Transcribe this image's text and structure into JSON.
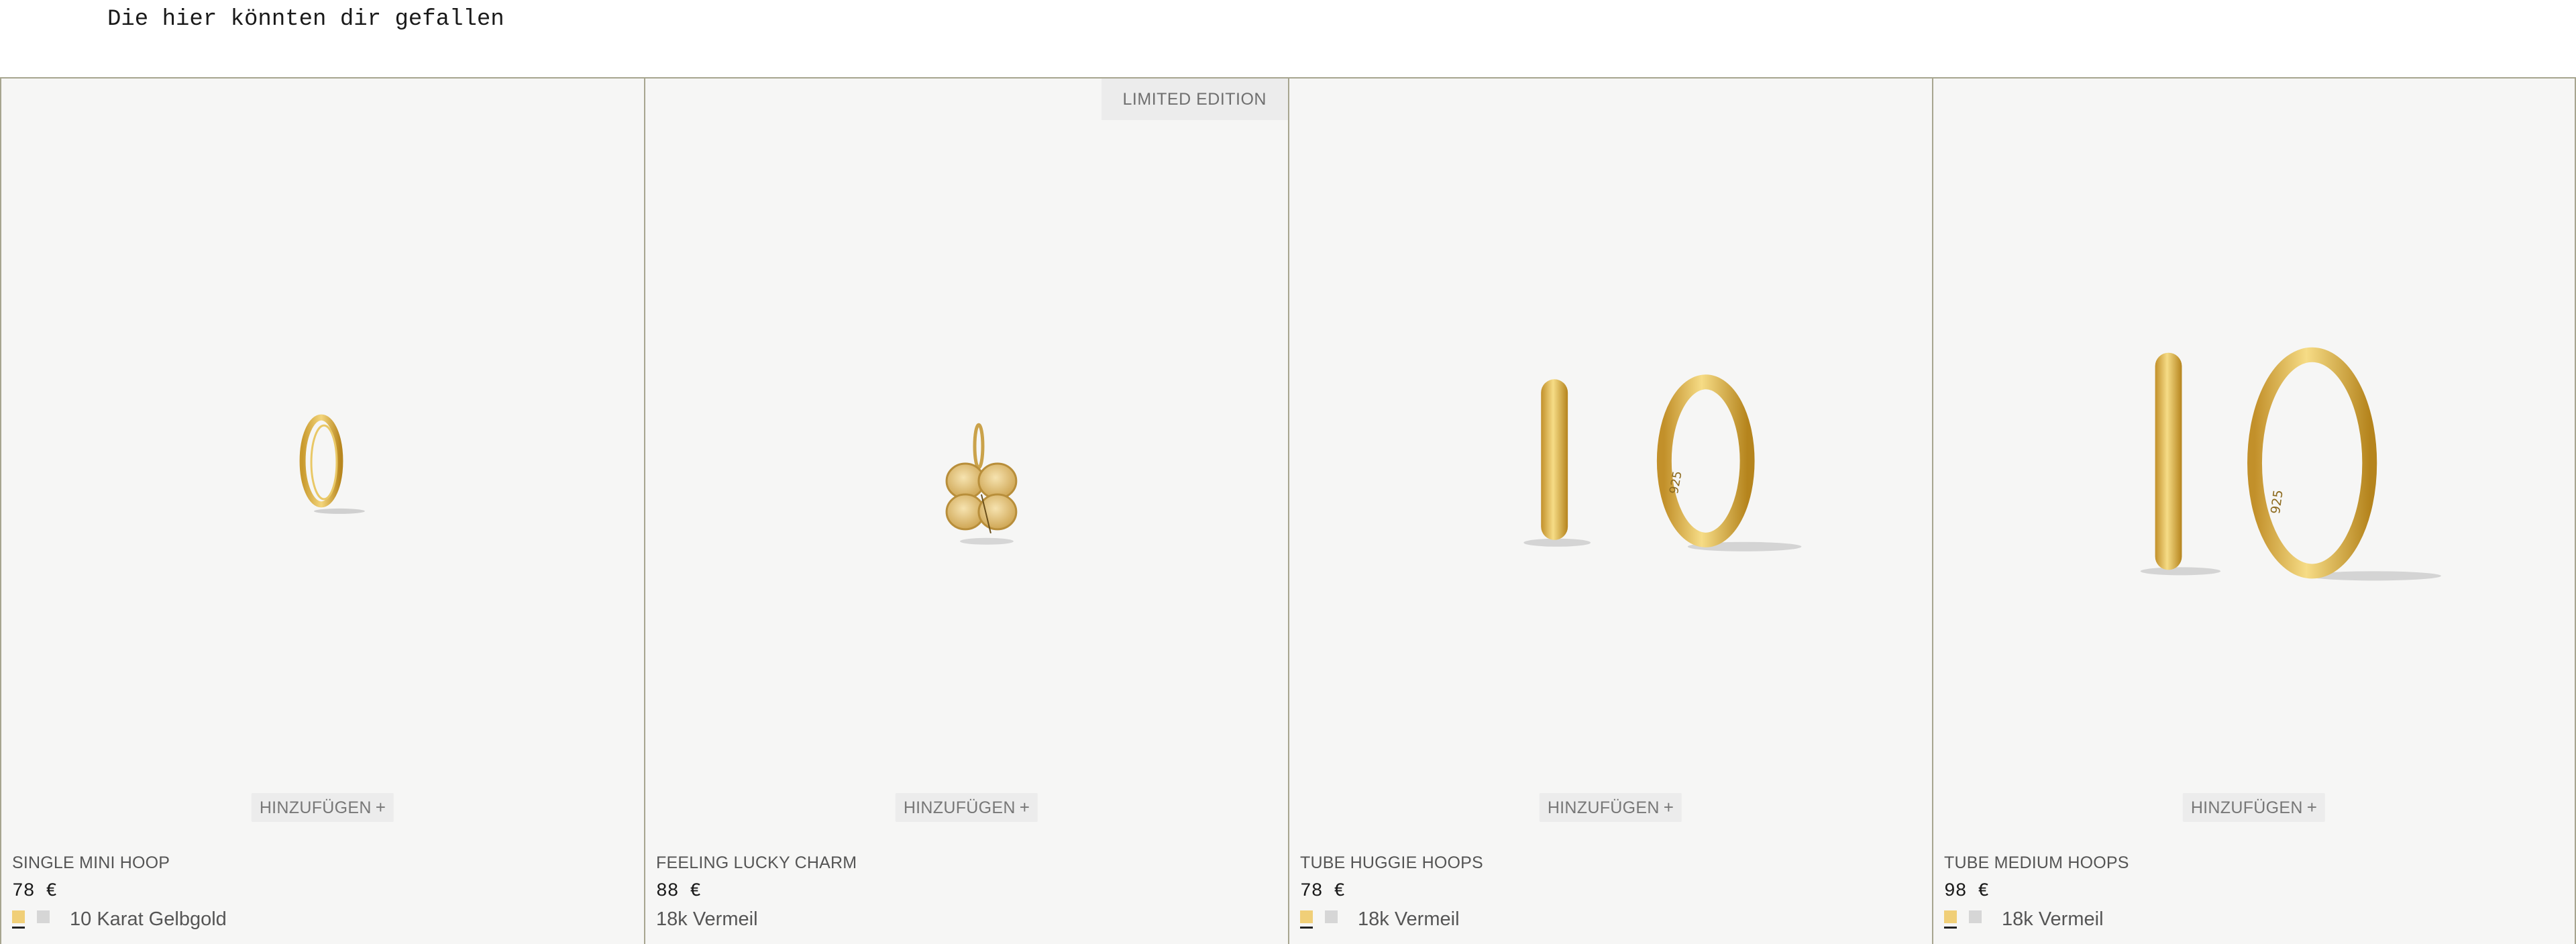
{
  "section": {
    "title": "Die hier könnten dir gefallen"
  },
  "colors": {
    "gold_swatch": "#f0cf78",
    "silver_swatch": "#d6d6d6",
    "card_border": "#a7a58f"
  },
  "products": [
    {
      "name": "SINGLE MINI HOOP",
      "price": "78 €",
      "material": "10 Karat Gelbgold",
      "add_label": "HINZUFÜGEN",
      "add_icon": "+",
      "badge": ""
    },
    {
      "name": "FEELING LUCKY CHARM",
      "price": "88 €",
      "material": "18k Vermeil",
      "add_label": "HINZUFÜGEN",
      "add_icon": "+",
      "badge": "LIMITED EDITION"
    },
    {
      "name": "TUBE HUGGIE HOOPS",
      "price": "78 €",
      "material": "18k Vermeil",
      "add_label": "HINZUFÜGEN",
      "add_icon": "+",
      "badge": ""
    },
    {
      "name": "TUBE MEDIUM HOOPS",
      "price": "98 €",
      "material": "18k Vermeil",
      "add_label": "HINZUFÜGEN",
      "add_icon": "+",
      "badge": ""
    }
  ]
}
